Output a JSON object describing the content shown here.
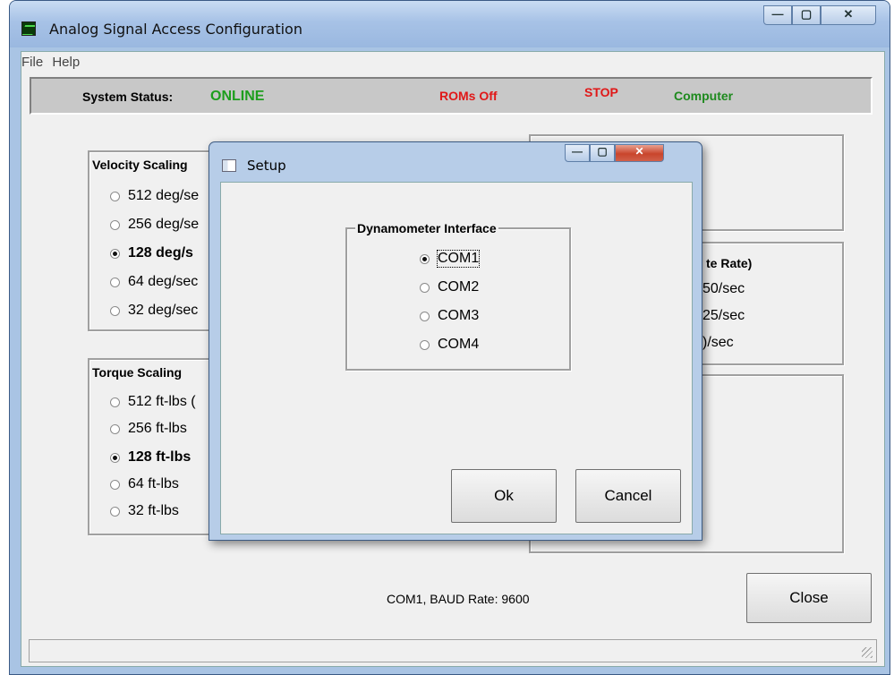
{
  "window": {
    "title": "Analog Signal Access Configuration",
    "min": "—",
    "max": "▢",
    "close": "✕"
  },
  "menu": {
    "file": "File",
    "help": "Help"
  },
  "status": {
    "label": "System Status:",
    "value": "ONLINE",
    "roms": "ROMs Off",
    "stop": "STOP",
    "mode": "Computer",
    "colors": {
      "online": "#1e9e1e",
      "roms": "#e01818",
      "stop": "#e01818",
      "computer": "#1e8a1e"
    }
  },
  "velocity": {
    "title": "Velocity Scaling",
    "options": [
      "512 deg/se",
      "256 deg/se",
      "128 deg/s",
      "64 deg/sec",
      "32 deg/sec"
    ],
    "selected": 2
  },
  "torque": {
    "title": "Torque Scaling",
    "options": [
      "512 ft-lbs (",
      "256 ft-lbs",
      "128 ft-lbs",
      "64 ft-lbs",
      "32 ft-lbs"
    ],
    "selected": 2
  },
  "update_rate": {
    "title": "te Rate)",
    "options": [
      "50/sec",
      "25/sec",
      ")/sec"
    ]
  },
  "footer": {
    "baud": "COM1,  BAUD Rate: 9600",
    "close": "Close"
  },
  "dialog": {
    "title": "Setup",
    "group_title": "Dynamometer Interface",
    "options": [
      "COM1",
      "COM2",
      "COM3",
      "COM4"
    ],
    "selected": 0,
    "ok": "Ok",
    "cancel": "Cancel",
    "min": "—",
    "max": "▢",
    "close": "✕"
  }
}
